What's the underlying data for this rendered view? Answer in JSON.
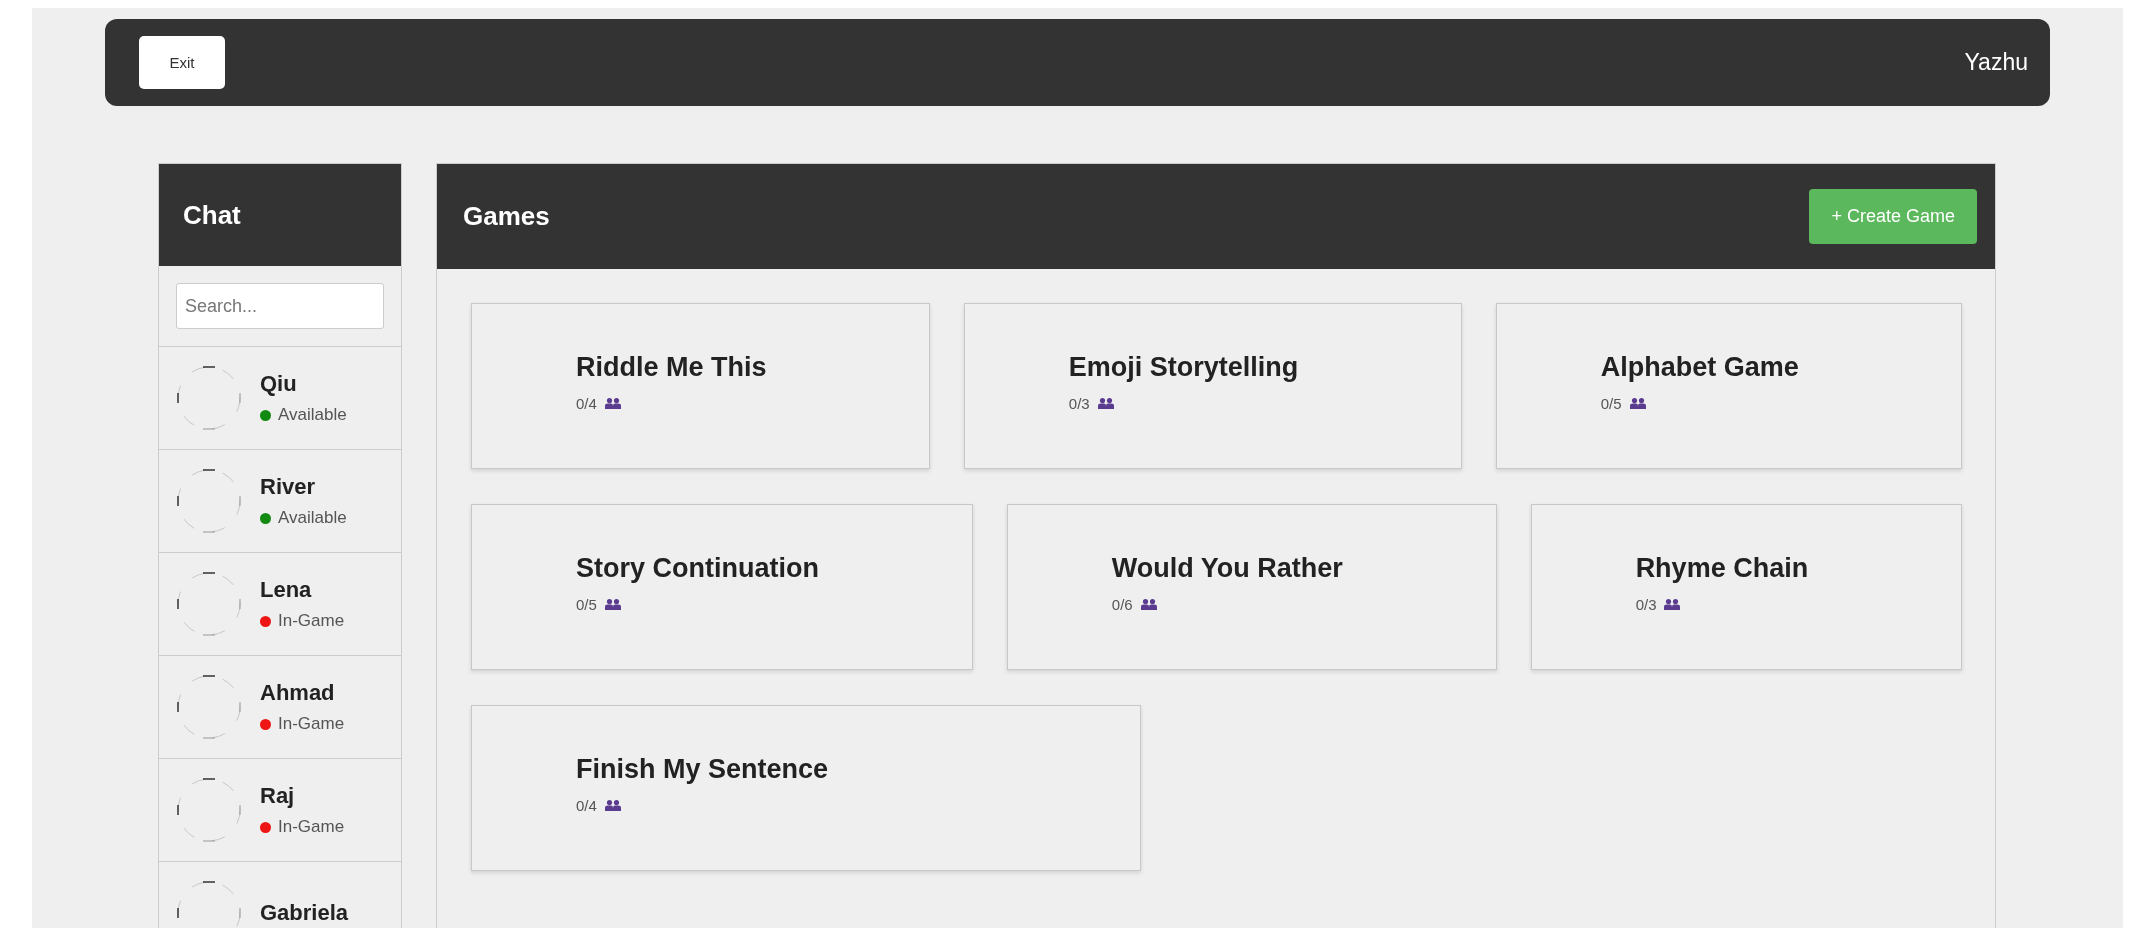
{
  "top_bar": {
    "exit_button": "Exit",
    "username": "Yazhu"
  },
  "chat": {
    "title": "Chat",
    "search": {
      "placeholder": "Search..."
    },
    "users": [
      {
        "name": "Qiu",
        "status": "Available",
        "color": "#128a12"
      },
      {
        "name": "River",
        "status": "Available",
        "color": "#128a12"
      },
      {
        "name": "Lena",
        "status": "In-Game",
        "color": "#ee1515"
      },
      {
        "name": "Ahmad",
        "status": "In-Game",
        "color": "#ee1515"
      },
      {
        "name": "Raj",
        "status": "In-Game",
        "color": "#ee1515"
      },
      {
        "name": "Gabriela"
      }
    ]
  },
  "games": {
    "title": "Games",
    "create_button": "+ Create Game",
    "items": [
      {
        "title": "Riddle Me This",
        "players": "0/4"
      },
      {
        "title": "Emoji Storytelling",
        "players": "0/3"
      },
      {
        "title": "Alphabet Game",
        "players": "0/5"
      },
      {
        "title": "Story Continuation",
        "players": "0/5"
      },
      {
        "title": "Would You Rather",
        "players": "0/6"
      },
      {
        "title": "Rhyme Chain",
        "players": "0/3"
      },
      {
        "title": "Finish My Sentence",
        "players": "0/4"
      }
    ]
  }
}
